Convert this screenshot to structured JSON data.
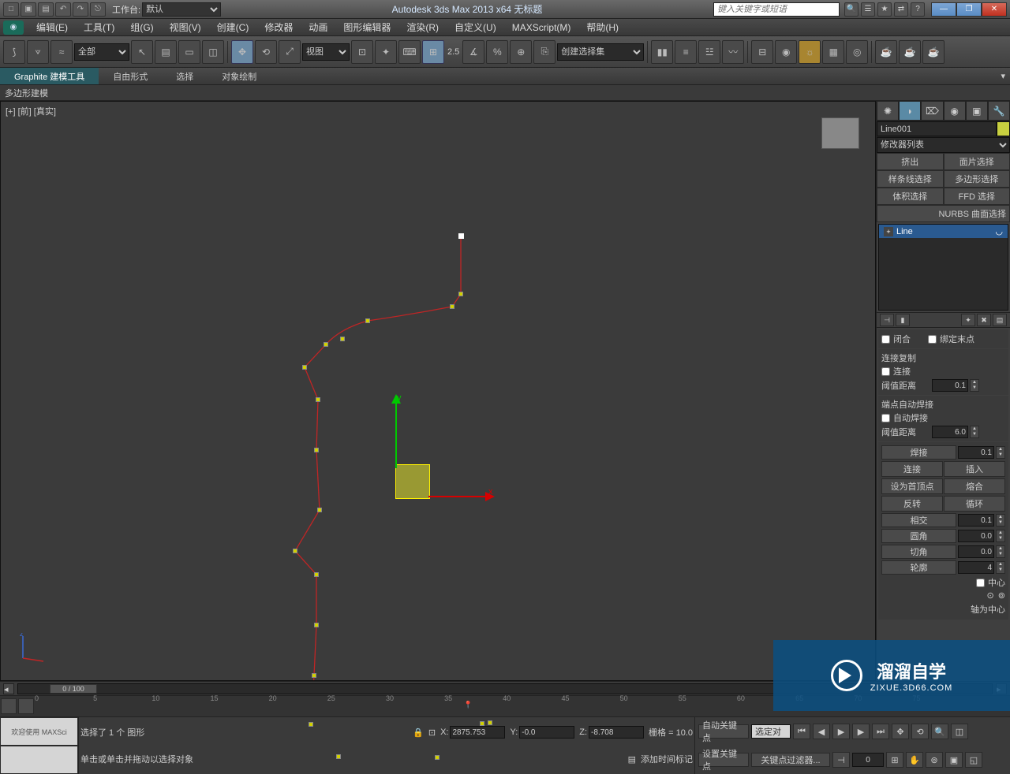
{
  "titlebar": {
    "workspace_label": "工作台:",
    "workspace_value": "默认",
    "app_title": "Autodesk 3ds Max  2013 x64     无标题",
    "search_placeholder": "键入关键字或短语"
  },
  "menu": {
    "items": [
      "编辑(E)",
      "工具(T)",
      "组(G)",
      "视图(V)",
      "创建(C)",
      "修改器",
      "动画",
      "图形编辑器",
      "渲染(R)",
      "自定义(U)",
      "MAXScript(M)",
      "帮助(H)"
    ]
  },
  "toolbar": {
    "filter_sel": "全部",
    "view_sel": "视图",
    "coord_label": "2.5",
    "named_sel": "创建选择集"
  },
  "ribbon": {
    "tabs": [
      "Graphite 建模工具",
      "自由形式",
      "选择",
      "对象绘制"
    ],
    "subtab": "多边形建模"
  },
  "viewport": {
    "label": "[+] [前] [真实]",
    "axis_x": "x",
    "axis_y": "y"
  },
  "cmd": {
    "object_name": "Line001",
    "modifier_list": "修改器列表",
    "buttons": [
      "挤出",
      "面片选择",
      "样条线选择",
      "多边形选择",
      "体积选择",
      "FFD 选择",
      "NURBS 曲面选择"
    ],
    "stack_item": "Line",
    "rollout": {
      "close_chk": "闭合",
      "bind_end_chk": "绑定末点",
      "connect_copy_hdr": "连接复制",
      "connect_chk": "连接",
      "threshold1_label": "阈值距离",
      "threshold1_val": "0.1",
      "auto_weld_hdr": "端点自动焊接",
      "auto_weld_chk": "自动焊接",
      "threshold2_label": "阈值距离",
      "threshold2_val": "6.0",
      "weld_btn": "焊接",
      "weld_val": "0.1",
      "connect_btn": "连接",
      "insert_btn": "插入",
      "make_first_btn": "设为首顶点",
      "fuse_btn": "熔合",
      "reverse_btn": "反转",
      "cycle_btn": "循环",
      "cross_btn": "相交",
      "cross_val": "0.1",
      "fillet_btn": "圆角",
      "fillet_val": "0.0",
      "chamfer_btn": "切角",
      "chamfer_val": "0.0",
      "outline_btn": "轮廓",
      "outline_val": "4",
      "center_chk": "中心",
      "axis_center": "轴为中心"
    }
  },
  "timeline": {
    "slider": "0 / 100"
  },
  "trackbar": {
    "ticks": [
      "0",
      "5",
      "10",
      "15",
      "20",
      "25",
      "30",
      "35",
      "40",
      "45",
      "50",
      "55",
      "60",
      "65",
      "70",
      "75"
    ]
  },
  "status": {
    "welcome": "欢迎使用  MAXSci",
    "sel_info": "选择了 1 个 图形",
    "prompt": "单击或单击并拖动以选择对象",
    "x_val": "2875.753",
    "y_val": "-0.0",
    "z_val": "-8.708",
    "grid": "栅格 = 10.0",
    "add_time_tag": "添加时间标记",
    "autokey": "自动关键点",
    "setkey": "设置关键点",
    "selected": "选定对",
    "key_filter": "关键点过滤器...",
    "frame_field": "0"
  },
  "watermark": {
    "big": "溜溜自学",
    "small": "ZIXUE.3D66.COM"
  }
}
